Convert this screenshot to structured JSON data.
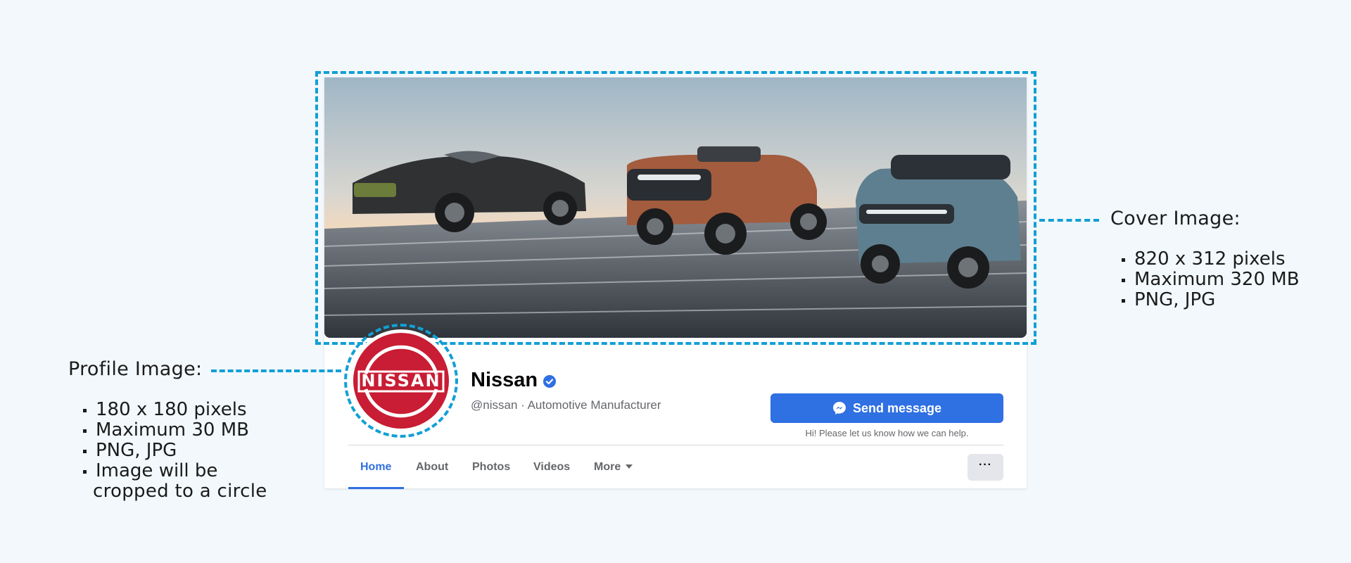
{
  "annotations": {
    "cover": {
      "title": "Cover Image:",
      "specs": [
        "820 x 312 pixels",
        "Maximum 320 MB",
        "PNG, JPG"
      ]
    },
    "profile": {
      "title": "Profile Image:",
      "specs": [
        "180 x 180 pixels",
        "Maximum 30 MB",
        "PNG, JPG",
        "Image will be",
        "cropped to a circle"
      ]
    },
    "accent_color": "#129fd6"
  },
  "profile": {
    "logo_text": "NISSAN",
    "name": "Nissan",
    "verified_icon": "verified-badge-icon",
    "subtitle": "@nissan · Automotive Manufacturer",
    "brand_color": "#c81d34"
  },
  "actions": {
    "send_message_label": "Send message",
    "send_message_icon": "messenger-icon",
    "hint": "Hi! Please let us know how we can help.",
    "more_options_label": "···"
  },
  "tabs": [
    {
      "label": "Home",
      "active": true
    },
    {
      "label": "About",
      "active": false
    },
    {
      "label": "Photos",
      "active": false
    },
    {
      "label": "Videos",
      "active": false
    },
    {
      "label": "More",
      "active": false
    }
  ],
  "colors": {
    "primary": "#2f70e2",
    "background": "#f2f8fb"
  }
}
